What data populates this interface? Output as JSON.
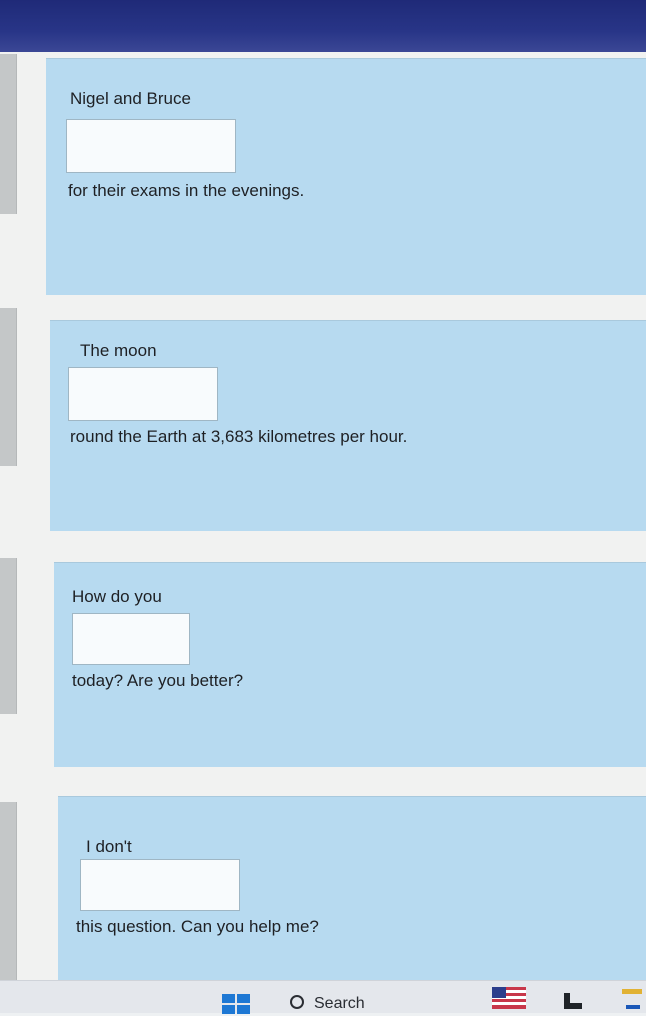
{
  "questions": [
    {
      "before": "Nigel and Bruce",
      "answer": "",
      "after": "for their exams in the evenings."
    },
    {
      "before": "The moon",
      "answer": "",
      "after": "round the Earth at 3,683 kilometres per hour."
    },
    {
      "before": "How do you",
      "answer": "",
      "after": "today? Are you better?"
    },
    {
      "before": "I don't",
      "answer": "",
      "after": "this question. Can you help me?"
    }
  ],
  "taskbar": {
    "search_label": "Search",
    "icons": [
      "windows-start-icon",
      "search-icon",
      "flag-widget-icon",
      "file-explorer-icon",
      "app-icon"
    ]
  },
  "colors": {
    "card_bg": "#b7daf0",
    "topbar": "#283587",
    "taskbar_bg": "#e4e7ec",
    "windows_blue": "#1e78d4"
  }
}
